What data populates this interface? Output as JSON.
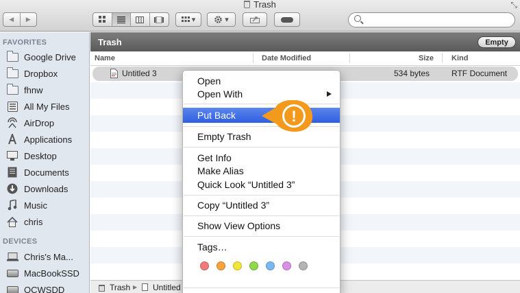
{
  "window": {
    "title": "Trash",
    "resize_icon": "⤡"
  },
  "toolbar": {
    "back_label": "◀",
    "forward_label": "▶",
    "view_icons": [
      "icon-view-icon",
      "list-view-icon",
      "column-view-icon",
      "coverflow-view-icon"
    ],
    "arrange_label": "▾",
    "action_label": "▾",
    "search_placeholder": ""
  },
  "sidebar": {
    "favorites_header": "FAVORITES",
    "favorites": [
      {
        "label": "Google Drive",
        "icon": "folder-icon"
      },
      {
        "label": "Dropbox",
        "icon": "folder-icon"
      },
      {
        "label": "fhnw",
        "icon": "folder-icon"
      },
      {
        "label": "All My Files",
        "icon": "all-files-icon"
      },
      {
        "label": "AirDrop",
        "icon": "airdrop-icon"
      },
      {
        "label": "Applications",
        "icon": "applications-icon"
      },
      {
        "label": "Desktop",
        "icon": "desktop-icon"
      },
      {
        "label": "Documents",
        "icon": "documents-icon"
      },
      {
        "label": "Downloads",
        "icon": "downloads-icon"
      },
      {
        "label": "Music",
        "icon": "music-icon"
      },
      {
        "label": "chris",
        "icon": "home-icon"
      }
    ],
    "devices_header": "DEVICES",
    "devices": [
      {
        "label": "Chris's Ma...",
        "icon": "computer-icon"
      },
      {
        "label": "MacBookSSD",
        "icon": "disk-icon"
      },
      {
        "label": "OCWSDD",
        "icon": "disk-icon"
      }
    ]
  },
  "main": {
    "folder_title": "Trash",
    "empty_button": "Empty",
    "columns": {
      "name": "Name",
      "date_modified": "Date Modified",
      "size": "Size",
      "kind": "Kind"
    },
    "files": [
      {
        "name": "Untitled 3",
        "date": "",
        "size": "534 bytes",
        "kind": "RTF Document"
      }
    ]
  },
  "pathbar": {
    "segments": [
      "Trash",
      "Untitled"
    ]
  },
  "context_menu": {
    "items": {
      "open": "Open",
      "open_with": "Open With",
      "put_back": "Put Back",
      "empty_trash": "Empty Trash",
      "get_info": "Get Info",
      "make_alias": "Make Alias",
      "quick_look": "Quick Look “Untitled 3”",
      "copy": "Copy “Untitled 3”",
      "show_view_options": "Show View Options",
      "tags": "Tags…"
    },
    "tag_colors": [
      "#f07a7a",
      "#f5a33a",
      "#f2e53a",
      "#8fd84a",
      "#7ab8f2",
      "#d88fe6",
      "#b4b4b4"
    ]
  },
  "callout": {
    "symbol": "!",
    "color": "#f39a1c"
  }
}
